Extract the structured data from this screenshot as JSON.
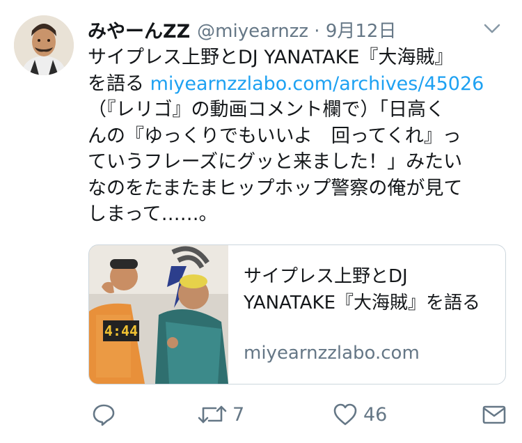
{
  "tweet": {
    "display_name": "みやーんZZ",
    "handle_date": "@miyearnzz · 9月12日",
    "text_lines": [
      {
        "text": "サイプレス上野とDJ YANATAKE『大海賊』"
      },
      {
        "text": "を語る ",
        "link": "miyearnzzlabo.com/archives/45026"
      },
      {
        "text": "（『レリゴ』の動画コメント欄で）「日高く"
      },
      {
        "text": "んの『ゆっくりでもいいよ　回ってくれ』っ"
      },
      {
        "text": "ていうフレーズにグッと来ました！」みたい"
      },
      {
        "text": "なのをたまたまヒップホップ警察の俺が見て"
      },
      {
        "text": "しまって……。"
      }
    ]
  },
  "card": {
    "title": "サイプレス上野とDJ YANATAKE『大海賊』を語る",
    "domain": "miyearnzzlabo.com",
    "image_text": "4:44"
  },
  "actions": {
    "reply_count": "",
    "retweet_count": "7",
    "like_count": "46"
  },
  "icons": {
    "menu": "chevron-down-icon",
    "reply": "reply-icon",
    "retweet": "retweet-icon",
    "like": "heart-icon",
    "dm": "mail-icon"
  },
  "colors": {
    "text": "#14171a",
    "secondary": "#657786",
    "link": "#1da1f2",
    "border": "#ccd6dd"
  }
}
